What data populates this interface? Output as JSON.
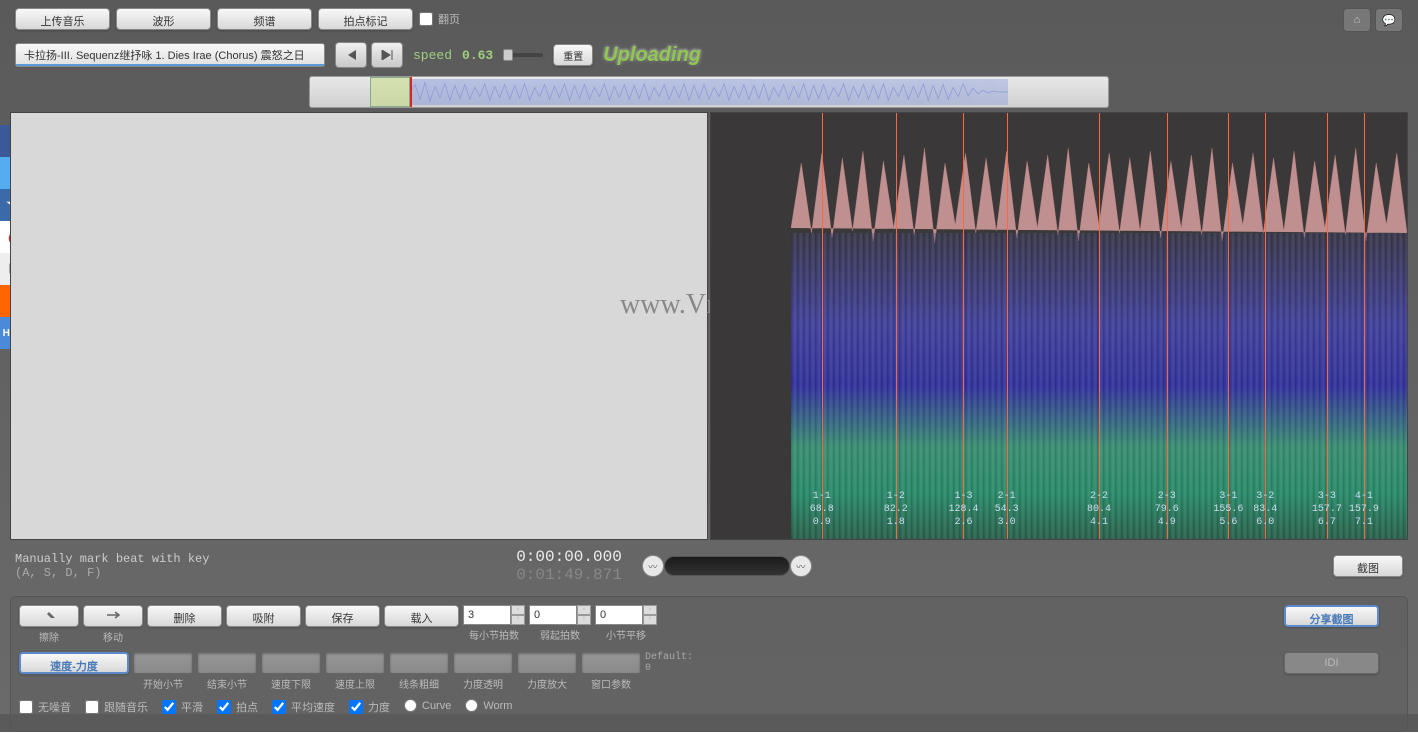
{
  "toolbar": {
    "upload": "上传音乐",
    "waveform": "波形",
    "spectrum": "频谱",
    "beatmark": "拍点标记",
    "pageflip": "翻页"
  },
  "track": {
    "title": "卡拉扬-III. Sequenz继抒咏 1. Dies Irae (Chorus) 震怒之日"
  },
  "speed": {
    "label": "speed",
    "value": "0.63",
    "reset": "重置"
  },
  "status": "Uploading",
  "watermark": "www.Vmus.net",
  "chart_data": {
    "type": "waveform_spectrogram",
    "beats": [
      {
        "x_pct": 5,
        "bar": "1-1",
        "v1": "68.8",
        "v2": "0.9"
      },
      {
        "x_pct": 17,
        "bar": "1-2",
        "v1": "82.2",
        "v2": "1.8"
      },
      {
        "x_pct": 28,
        "bar": "1-3",
        "v1": "128.4",
        "v2": "2.6"
      },
      {
        "x_pct": 35,
        "bar": "2-1",
        "v1": "54.3",
        "v2": "3.0"
      },
      {
        "x_pct": 50,
        "bar": "2-2",
        "v1": "80.4",
        "v2": "4.1"
      },
      {
        "x_pct": 61,
        "bar": "2-3",
        "v1": "79.6",
        "v2": "4.9"
      },
      {
        "x_pct": 71,
        "bar": "3-1",
        "v1": "155.6",
        "v2": "5.6"
      },
      {
        "x_pct": 77,
        "bar": "3-2",
        "v1": "83.4",
        "v2": "6.0"
      },
      {
        "x_pct": 87,
        "bar": "3-3",
        "v1": "157.7",
        "v2": "6.7"
      },
      {
        "x_pct": 93,
        "bar": "4-1",
        "v1": "157.9",
        "v2": "7.1"
      }
    ]
  },
  "info": {
    "line1": "Manually mark beat with key",
    "line2": "(A, S, D, F)",
    "time_current": "0:00:00.000",
    "time_total": "0:01:49.871",
    "screenshot": "截图"
  },
  "controls": {
    "erase": "擦除",
    "move": "移动",
    "delete": "删除",
    "snap": "吸附",
    "save": "保存",
    "load": "载入",
    "beats_per_bar": {
      "value": "3",
      "label": "每小节拍数"
    },
    "pickup_beats": {
      "value": "0",
      "label": "弱起拍数"
    },
    "bar_offset": {
      "value": "0",
      "label": "小节平移"
    },
    "share": "分享截图",
    "tempo_dyn": "速度-力度",
    "start_bar": "开始小节",
    "end_bar": "结束小节",
    "tempo_low": "速度下限",
    "tempo_high": "速度上限",
    "line_width": "线条粗细",
    "dyn_alpha": "力度透明",
    "dyn_zoom": "力度放大",
    "window_params": "窗口参数",
    "default": "Default:",
    "default_val": "0",
    "idi": "IDI",
    "no_noise": "无噪音",
    "follow": "跟随音乐",
    "smooth": "平滑",
    "beat": "拍点",
    "avg_tempo": "平均速度",
    "dynamics": "力度",
    "curve": "Curve",
    "worm": "Worm"
  }
}
